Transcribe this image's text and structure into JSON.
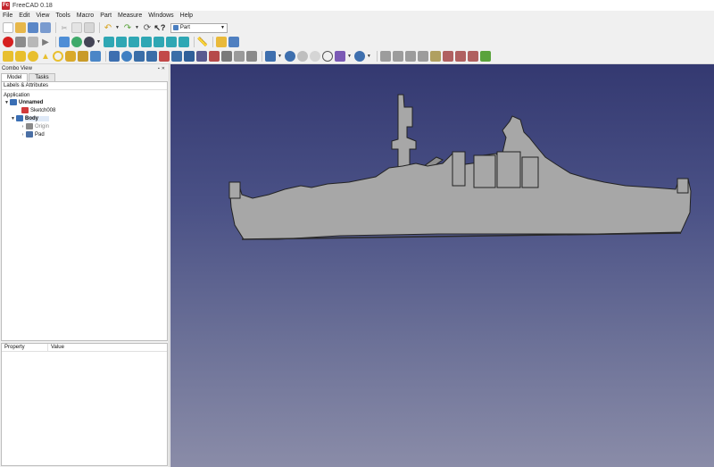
{
  "window": {
    "title": "FreeCAD 0.18",
    "icon_letters": "Fc"
  },
  "menu": [
    "File",
    "Edit",
    "View",
    "Tools",
    "Macro",
    "Part",
    "Measure",
    "Windows",
    "Help"
  ],
  "workbench": {
    "selected": "Part"
  },
  "combo_view": {
    "title": "Combo View",
    "tabs": [
      "Model",
      "Tasks"
    ],
    "tree_header": "Labels & Attributes",
    "section": "Application",
    "tree": [
      {
        "label": "Unnamed",
        "bold": true,
        "twisty": "▼",
        "indent": 0,
        "icon_color": "#3a6fb5"
      },
      {
        "label": "Sketch008",
        "bold": false,
        "twisty": "",
        "indent": 1,
        "icon_color": "#d23a3a"
      },
      {
        "label": "Body",
        "bold": true,
        "twisty": "▼",
        "indent": 1,
        "icon_color": "#3a6fb5",
        "highlight": true
      },
      {
        "label": "Origin",
        "bold": false,
        "twisty": "›",
        "indent": 2,
        "icon_color": "#8a8a8a",
        "greyed": true
      },
      {
        "label": "Pad",
        "bold": false,
        "twisty": "›",
        "indent": 2,
        "icon_color": "#4a6fa5"
      }
    ]
  },
  "property_view": {
    "col_property": "Property",
    "col_value": "Value"
  },
  "colors": {
    "ship_fill": "#a7a7a7",
    "ship_stroke": "#232323",
    "viewport_top": "#343971",
    "viewport_bottom": "#8a8ca8"
  },
  "toolbar_icons": {
    "row1": [
      "new-file-icon",
      "open-file-icon",
      "save-icon",
      "save-as-icon",
      "cut-icon",
      "copy-icon",
      "paste-icon",
      "undo-icon",
      "redo-icon",
      "refresh-icon",
      "whats-this-icon"
    ],
    "row2": [
      "record-macro-icon",
      "stop-macro-icon",
      "macros-icon",
      "run-macro-icon",
      "fit-all-icon",
      "fit-selection-icon",
      "draw-style-icon",
      "isometric-view-icon",
      "front-view-icon",
      "top-view-icon",
      "right-view-icon",
      "rear-view-icon",
      "bottom-view-icon",
      "left-view-icon",
      "measure-icon",
      "part-icon",
      "group-icon"
    ],
    "row3": [
      "cube-icon",
      "cylinder-icon",
      "sphere-icon",
      "cone-icon",
      "torus-icon",
      "tube-icon",
      "primitives-icon",
      "shape-builder-icon",
      "extrude-icon",
      "revolve-icon",
      "mirror-icon",
      "fillet-icon",
      "chamfer-icon",
      "make-face-icon",
      "ruled-surface-icon",
      "loft-icon",
      "sweep-icon",
      "section-icon",
      "cross-sections-icon",
      "offset-icon",
      "thickness-icon",
      "projection-icon",
      "compound-icon",
      "boolean-icon",
      "cut-tool-icon",
      "fuse-icon",
      "common-icon",
      "join-icon",
      "split-icon",
      "check-geometry-icon",
      "defeaturing-icon",
      "measure-linear-icon",
      "measure-angular-icon",
      "measure-refresh-icon",
      "measure-clear-icon",
      "measure-toggle-icon",
      "measure-3d-icon",
      "measure-delta-icon"
    ]
  }
}
